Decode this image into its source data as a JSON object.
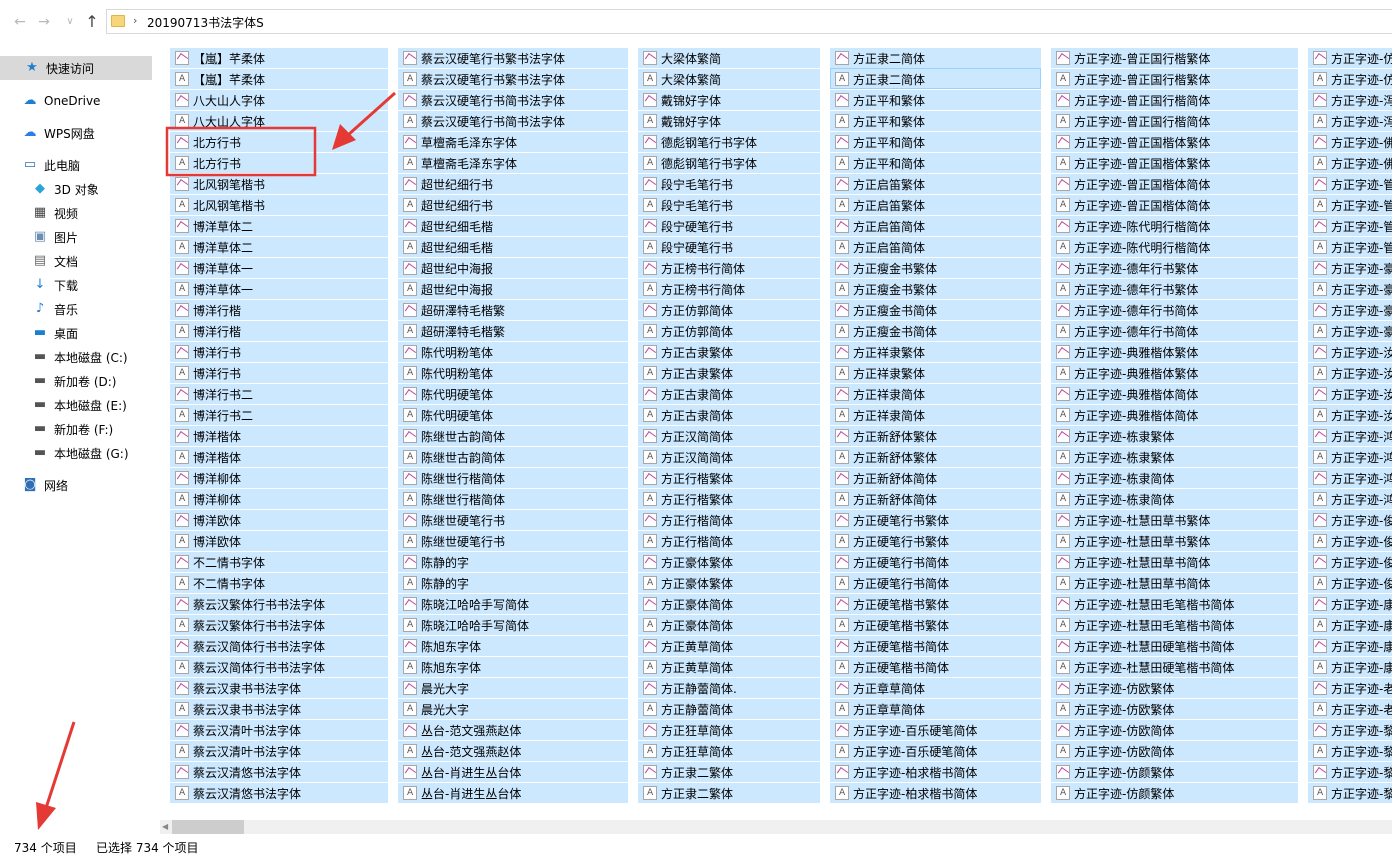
{
  "address": {
    "back_glyph": "←",
    "forward_glyph": "→",
    "dropdown_glyph": "∨",
    "up_glyph": "↑",
    "chevron": "›",
    "path": "20190713书法字体S"
  },
  "sidebar": {
    "items": [
      {
        "label": "快速访问",
        "icon": "star-icon",
        "glyph": "★",
        "color": "#1e7fd1"
      },
      {
        "label": "OneDrive",
        "icon": "cloud-icon",
        "glyph": "☁",
        "color": "#1e7fd1"
      },
      {
        "label": "WPS网盘",
        "icon": "wps-cloud-icon",
        "glyph": "☁",
        "color": "#2b7de9"
      },
      {
        "label": "此电脑",
        "icon": "computer-icon",
        "glyph": "▭",
        "color": "#2f6fb5"
      },
      {
        "label": "3D 对象",
        "icon": "cube-icon",
        "glyph": "◆",
        "color": "#29a3d8"
      },
      {
        "label": "视频",
        "icon": "film-icon",
        "glyph": "▦",
        "color": "#444444"
      },
      {
        "label": "图片",
        "icon": "picture-icon",
        "glyph": "▣",
        "color": "#6a8fb3"
      },
      {
        "label": "文档",
        "icon": "document-icon",
        "glyph": "▤",
        "color": "#6a6a6a"
      },
      {
        "label": "下载",
        "icon": "download-icon",
        "glyph": "↓",
        "color": "#1e7fd1"
      },
      {
        "label": "音乐",
        "icon": "music-icon",
        "glyph": "♪",
        "color": "#1e7fd1"
      },
      {
        "label": "桌面",
        "icon": "desktop-icon",
        "glyph": "▬",
        "color": "#1e7fd1"
      },
      {
        "label": "本地磁盘 (C:)",
        "icon": "windows-drive-icon",
        "glyph": "▬",
        "color": "#555555"
      },
      {
        "label": "新加卷 (D:)",
        "icon": "drive-icon",
        "glyph": "▬",
        "color": "#555555"
      },
      {
        "label": "本地磁盘 (E:)",
        "icon": "drive-icon",
        "glyph": "▬",
        "color": "#555555"
      },
      {
        "label": "新加卷 (F:)",
        "icon": "drive-icon",
        "glyph": "▬",
        "color": "#555555"
      },
      {
        "label": "本地磁盘 (G:)",
        "icon": "drive-icon",
        "glyph": "▬",
        "color": "#555555"
      },
      {
        "label": "网络",
        "icon": "network-icon",
        "glyph": "◙",
        "color": "#2f6fb5"
      }
    ]
  },
  "files": {
    "columns": [
      [
        "【嵐】芊柔体",
        "【嵐】芊柔体",
        "八大山人字体",
        "八大山人字体",
        "北方行书",
        "北方行书",
        "北风钢笔楷书",
        "北风钢笔楷书",
        "博洋草体二",
        "博洋草体二",
        "博洋草体一",
        "博洋草体一",
        "博洋行楷",
        "博洋行楷",
        "博洋行书",
        "博洋行书",
        "博洋行书二",
        "博洋行书二",
        "博洋楷体",
        "博洋楷体",
        "博洋柳体",
        "博洋柳体",
        "博洋欧体",
        "博洋欧体",
        "不二情书字体",
        "不二情书字体",
        "蔡云汉繁体行书书法字体",
        "蔡云汉繁体行书书法字体",
        "蔡云汉简体行书书法字体",
        "蔡云汉简体行书书法字体",
        "蔡云汉隶书书法字体",
        "蔡云汉隶书书法字体",
        "蔡云汉清叶书法字体",
        "蔡云汉清叶书法字体",
        "蔡云汉清悠书法字体",
        "蔡云汉清悠书法字体"
      ],
      [
        "蔡云汉硬笔行书繁书法字体",
        "蔡云汉硬笔行书繁书法字体",
        "蔡云汉硬笔行书简书法字体",
        "蔡云汉硬笔行书简书法字体",
        "草檀斋毛泽东字体",
        "草檀斋毛泽东字体",
        "超世纪细行书",
        "超世纪细行书",
        "超世纪细毛楷",
        "超世纪细毛楷",
        "超世纪中海报",
        "超世纪中海报",
        "超研澤特毛楷繁",
        "超研澤特毛楷繁",
        "陈代明粉笔体",
        "陈代明粉笔体",
        "陈代明硬笔体",
        "陈代明硬笔体",
        "陈继世古韵简体",
        "陈继世古韵简体",
        "陈继世行楷简体",
        "陈继世行楷简体",
        "陈继世硬笔行书",
        "陈继世硬笔行书",
        "陈静的字",
        "陈静的字",
        "陈晓江哈哈手写简体",
        "陈晓江哈哈手写简体",
        "陈旭东字体",
        "陈旭东字体",
        "晨光大字",
        "晨光大字",
        "丛台-范文强燕赵体",
        "丛台-范文强燕赵体",
        "丛台-肖进生丛台体",
        "丛台-肖进生丛台体"
      ],
      [
        "大梁体繁简",
        "大梁体繁简",
        "戴锦好字体",
        "戴锦好字体",
        "德彪钢笔行书字体",
        "德彪钢笔行书字体",
        "段宁毛笔行书",
        "段宁毛笔行书",
        "段宁硬笔行书",
        "段宁硬笔行书",
        "方正榜书行简体",
        "方正榜书行简体",
        "方正仿郭简体",
        "方正仿郭简体",
        "方正古隶繁体",
        "方正古隶繁体",
        "方正古隶简体",
        "方正古隶简体",
        "方正汉简简体",
        "方正汉简简体",
        "方正行楷繁体",
        "方正行楷繁体",
        "方正行楷简体",
        "方正行楷简体",
        "方正豪体繁体",
        "方正豪体繁体",
        "方正豪体简体",
        "方正豪体简体",
        "方正黄草简体",
        "方正黄草简体",
        "方正静蕾简体.",
        "方正静蕾简体",
        "方正狂草简体",
        "方正狂草简体",
        "方正隶二繁体",
        "方正隶二繁体"
      ],
      [
        "方正隶二简体",
        "方正隶二简体",
        "方正平和繁体",
        "方正平和繁体",
        "方正平和简体",
        "方正平和简体",
        "方正启笛繁体",
        "方正启笛繁体",
        "方正启笛简体",
        "方正启笛简体",
        "方正瘦金书繁体",
        "方正瘦金书繁体",
        "方正瘦金书简体",
        "方正瘦金书简体",
        "方正祥隶繁体",
        "方正祥隶繁体",
        "方正祥隶简体",
        "方正祥隶简体",
        "方正新舒体繁体",
        "方正新舒体繁体",
        "方正新舒体简体",
        "方正新舒体简体",
        "方正硬笔行书繁体",
        "方正硬笔行书繁体",
        "方正硬笔行书简体",
        "方正硬笔行书简体",
        "方正硬笔楷书繁体",
        "方正硬笔楷书繁体",
        "方正硬笔楷书简体",
        "方正硬笔楷书简体",
        "方正章草简体",
        "方正章草简体",
        "方正字迹-百乐硬笔简体",
        "方正字迹-百乐硬笔简体",
        "方正字迹-柏求楷书简体",
        "方正字迹-柏求楷书简体"
      ],
      [
        "方正字迹-曾正国行楷繁体",
        "方正字迹-曾正国行楷繁体",
        "方正字迹-曾正国行楷简体",
        "方正字迹-曾正国行楷简体",
        "方正字迹-曾正国楷体繁体",
        "方正字迹-曾正国楷体繁体",
        "方正字迹-曾正国楷体简体",
        "方正字迹-曾正国楷体简体",
        "方正字迹-陈代明行楷简体",
        "方正字迹-陈代明行楷简体",
        "方正字迹-德年行书繁体",
        "方正字迹-德年行书繁体",
        "方正字迹-德年行书简体",
        "方正字迹-德年行书简体",
        "方正字迹-典雅楷体繁体",
        "方正字迹-典雅楷体繁体",
        "方正字迹-典雅楷体简体",
        "方正字迹-典雅楷体简体",
        "方正字迹-栋隶繁体",
        "方正字迹-栋隶繁体",
        "方正字迹-栋隶简体",
        "方正字迹-栋隶简体",
        "方正字迹-杜慧田草书繁体",
        "方正字迹-杜慧田草书繁体",
        "方正字迹-杜慧田草书简体",
        "方正字迹-杜慧田草书简体",
        "方正字迹-杜慧田毛笔楷书简体",
        "方正字迹-杜慧田毛笔楷书简体",
        "方正字迹-杜慧田硬笔楷书简体",
        "方正字迹-杜慧田硬笔楷书简体",
        "方正字迹-仿欧繁体",
        "方正字迹-仿欧繁体",
        "方正字迹-仿欧简体",
        "方正字迹-仿欧简体",
        "方正字迹-仿颜繁体",
        "方正字迹-仿颜繁体"
      ],
      [
        "方正字迹-仿",
        "方正字迹-仿",
        "方正字迹-泻",
        "方正字迹-泻",
        "方正字迹-佛",
        "方正字迹-佛",
        "方正字迹-管",
        "方正字迹-管",
        "方正字迹-管",
        "方正字迹-管",
        "方正字迹-豪",
        "方正字迹-豪",
        "方正字迹-豪",
        "方正字迹-豪",
        "方正字迹-汝",
        "方正字迹-汝",
        "方正字迹-汝",
        "方正字迹-汝",
        "方正字迹-鸿",
        "方正字迹-鸿",
        "方正字迹-鸿",
        "方正字迹-鸿",
        "方正字迹-俊",
        "方正字迹-俊",
        "方正字迹-俊",
        "方正字迹-俊",
        "方正字迹-康",
        "方正字迹-康",
        "方正字迹-康",
        "方正字迹-康",
        "方正字迹-老",
        "方正字迹-老",
        "方正字迹-黎",
        "方正字迹-黎",
        "方正字迹-黎",
        "方正字迹-黎"
      ]
    ]
  },
  "status": {
    "count": "734 个项目",
    "selected": "已选择 734 个项目"
  },
  "annotations": {
    "highlight_color": "#e53935",
    "arrow_color": "#e53935"
  }
}
